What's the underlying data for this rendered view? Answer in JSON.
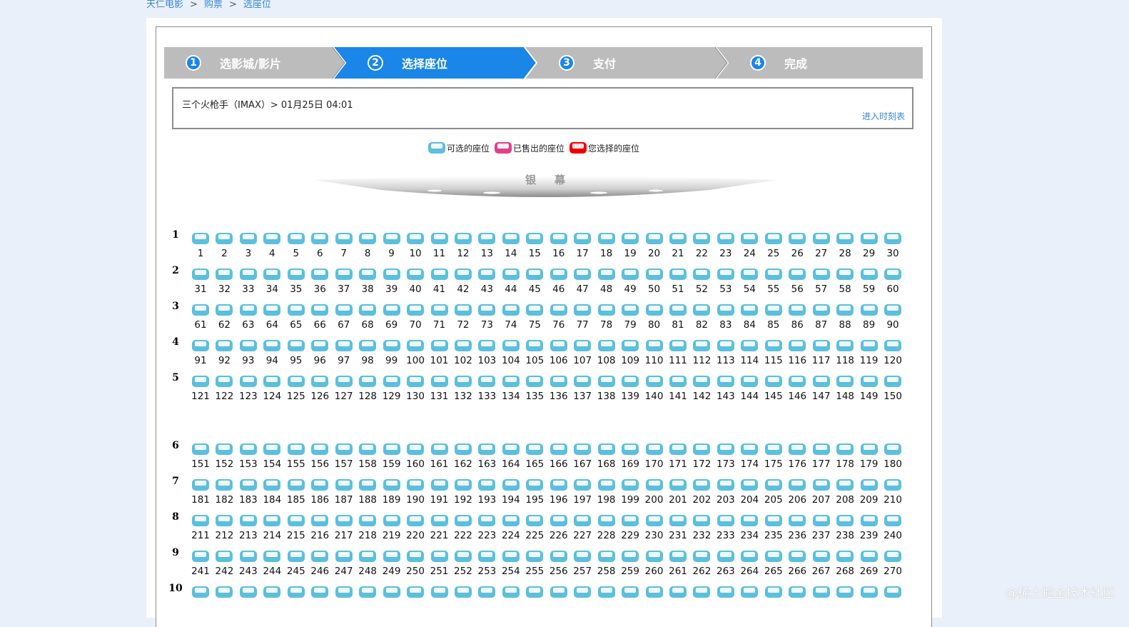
{
  "breadcrumb": {
    "home": "天仁电影",
    "buy": "购票",
    "seat": "选座位",
    "separator": ">"
  },
  "steps": [
    {
      "num": "1",
      "label": "选影城/影片",
      "active": false
    },
    {
      "num": "2",
      "label": "选择座位",
      "active": true
    },
    {
      "num": "3",
      "label": "支付",
      "active": false
    },
    {
      "num": "4",
      "label": "完成",
      "active": false
    }
  ],
  "show": {
    "title": "三个火枪手（IMAX）>  01月25日 04:01",
    "schedule_link": "进入时刻表"
  },
  "legend": {
    "available": "可选的座位",
    "sold": "已售出的座位",
    "selected": "您选择的座位"
  },
  "screen_label": "银幕",
  "colors": {
    "available": "#5bbfdd",
    "sold": "#e0408a",
    "selected": "#f00000",
    "step_active": "#1a86e8",
    "step_inactive": "#bcbcbc"
  },
  "seating": {
    "rows": [
      "1",
      "2",
      "3",
      "4",
      "5",
      "6",
      "7",
      "8",
      "9",
      "10"
    ],
    "seats_per_row": 30,
    "seat_numbers": [
      [
        "1",
        "2",
        "3",
        "4",
        "5",
        "6",
        "7",
        "8",
        "9",
        "10",
        "11",
        "12",
        "13",
        "14",
        "15",
        "16",
        "17",
        "18",
        "19",
        "20",
        "21",
        "22",
        "23",
        "24",
        "25",
        "26",
        "27",
        "28",
        "29",
        "30"
      ],
      [
        "31",
        "32",
        "33",
        "34",
        "35",
        "36",
        "37",
        "38",
        "39",
        "40",
        "41",
        "42",
        "43",
        "44",
        "45",
        "46",
        "47",
        "48",
        "49",
        "50",
        "51",
        "52",
        "53",
        "54",
        "55",
        "56",
        "57",
        "58",
        "59",
        "60"
      ],
      [
        "61",
        "62",
        "63",
        "64",
        "65",
        "66",
        "67",
        "68",
        "69",
        "70",
        "71",
        "72",
        "73",
        "74",
        "75",
        "76",
        "77",
        "78",
        "79",
        "80",
        "81",
        "82",
        "83",
        "84",
        "85",
        "86",
        "87",
        "88",
        "89",
        "90"
      ],
      [
        "91",
        "92",
        "93",
        "94",
        "95",
        "96",
        "97",
        "98",
        "99",
        "100",
        "101",
        "102",
        "103",
        "104",
        "105",
        "106",
        "107",
        "108",
        "109",
        "110",
        "111",
        "112",
        "113",
        "114",
        "115",
        "116",
        "117",
        "118",
        "119",
        "120"
      ],
      [
        "121",
        "122",
        "123",
        "124",
        "125",
        "126",
        "127",
        "128",
        "129",
        "130",
        "131",
        "132",
        "133",
        "134",
        "135",
        "136",
        "137",
        "138",
        "139",
        "140",
        "141",
        "142",
        "143",
        "144",
        "145",
        "146",
        "147",
        "148",
        "149",
        "150"
      ],
      [
        "151",
        "152",
        "153",
        "154",
        "155",
        "156",
        "157",
        "158",
        "159",
        "160",
        "161",
        "162",
        "163",
        "164",
        "165",
        "166",
        "167",
        "168",
        "169",
        "170",
        "171",
        "172",
        "173",
        "174",
        "175",
        "176",
        "177",
        "178",
        "179",
        "180"
      ],
      [
        "181",
        "182",
        "183",
        "184",
        "185",
        "186",
        "187",
        "188",
        "189",
        "190",
        "191",
        "192",
        "193",
        "194",
        "195",
        "196",
        "197",
        "198",
        "199",
        "200",
        "201",
        "202",
        "203",
        "204",
        "205",
        "206",
        "207",
        "208",
        "209",
        "210"
      ],
      [
        "211",
        "212",
        "213",
        "214",
        "215",
        "216",
        "217",
        "218",
        "219",
        "220",
        "221",
        "222",
        "223",
        "224",
        "225",
        "226",
        "227",
        "228",
        "229",
        "230",
        "231",
        "232",
        "233",
        "234",
        "235",
        "236",
        "237",
        "238",
        "239",
        "240"
      ],
      [
        "241",
        "242",
        "243",
        "244",
        "245",
        "246",
        "247",
        "248",
        "249",
        "250",
        "251",
        "252",
        "253",
        "254",
        "255",
        "256",
        "257",
        "258",
        "259",
        "260",
        "261",
        "262",
        "263",
        "264",
        "265",
        "266",
        "267",
        "268",
        "269",
        "270"
      ],
      [
        "",
        "",
        "",
        "",
        "",
        "",
        "",
        "",
        "",
        "",
        "",
        "",
        "",
        "",
        "",
        "",
        "",
        "",
        "",
        "",
        "",
        "",
        "",
        "",
        "",
        "",
        "",
        "",
        "",
        ""
      ]
    ]
  },
  "watermark": "@稀土掘金技术社区"
}
